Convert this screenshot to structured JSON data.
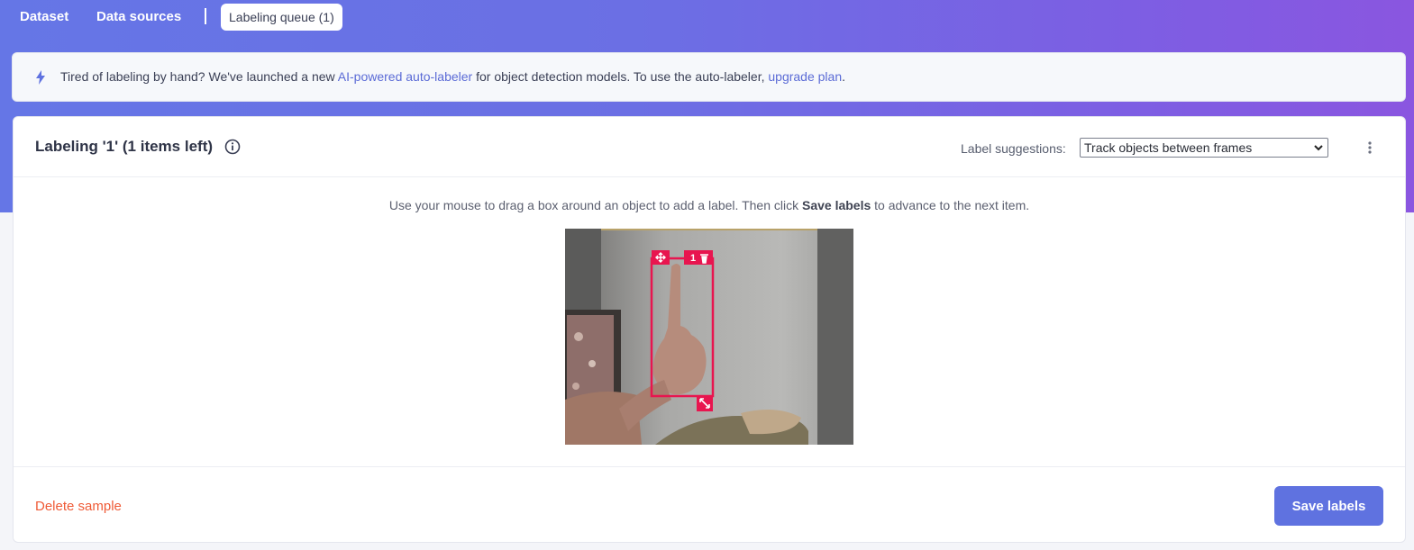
{
  "tabs": {
    "dataset": "Dataset",
    "data_sources": "Data sources",
    "labeling_queue": "Labeling queue (1)"
  },
  "banner": {
    "icon": "bolt-icon",
    "text_before": "Tired of labeling by hand? We've launched a new ",
    "link1": "AI-powered auto-labeler",
    "text_middle": " for object detection models. To use the auto-labeler, ",
    "link2": "upgrade plan",
    "text_after": "."
  },
  "header": {
    "title": "Labeling '1' (1 items left)",
    "suggestions_label": "Label suggestions:",
    "suggestions_value": "Track objects between frames"
  },
  "hint": {
    "before": "Use your mouse to drag a box around an object to add a label. Then click ",
    "bold": "Save labels",
    "after": " to advance to the next item."
  },
  "bounding_box": {
    "label": "1",
    "color": "#e8154f"
  },
  "footer": {
    "delete_label": "Delete sample",
    "save_label": "Save labels"
  },
  "colors": {
    "accent": "#5f72e0",
    "danger": "#ef5b37",
    "link": "#5b6bd6"
  }
}
